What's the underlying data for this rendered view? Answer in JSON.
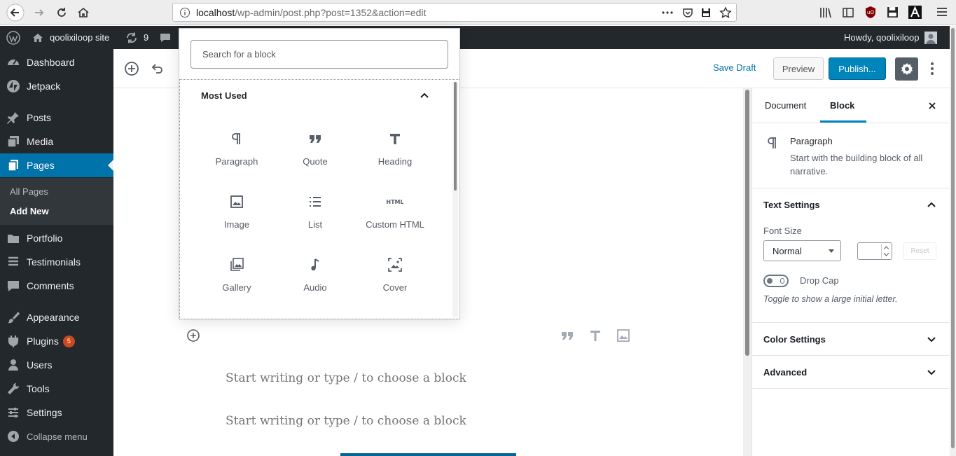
{
  "browser": {
    "url_host": "localhost",
    "url_path": "/wp-admin/post.php?post=1352&action=edit"
  },
  "admin_bar": {
    "site_name": "qoolixiloop site",
    "updates_count": "9",
    "greeting": "Howdy, qoolixiloop"
  },
  "admin_menu": {
    "items": [
      {
        "label": "Dashboard"
      },
      {
        "label": "Jetpack"
      },
      {
        "label": "Posts"
      },
      {
        "label": "Media"
      },
      {
        "label": "Pages"
      },
      {
        "label": "Portfolio"
      },
      {
        "label": "Testimonials"
      },
      {
        "label": "Comments"
      },
      {
        "label": "Appearance"
      },
      {
        "label": "Plugins",
        "badge": "5"
      },
      {
        "label": "Users"
      },
      {
        "label": "Tools"
      },
      {
        "label": "Settings"
      },
      {
        "label": "Collapse menu"
      }
    ],
    "submenu": [
      {
        "label": "All Pages"
      },
      {
        "label": "Add New"
      }
    ]
  },
  "editor_header": {
    "save_draft": "Save Draft",
    "preview": "Preview",
    "publish": "Publish..."
  },
  "inserter": {
    "search_placeholder": "Search for a block",
    "section_title": "Most Used",
    "blocks": [
      {
        "label": "Paragraph",
        "icon": "paragraph-icon"
      },
      {
        "label": "Quote",
        "icon": "quote-icon"
      },
      {
        "label": "Heading",
        "icon": "heading-icon"
      },
      {
        "label": "Image",
        "icon": "image-icon"
      },
      {
        "label": "List",
        "icon": "list-icon"
      },
      {
        "label": "Custom HTML",
        "icon": "html-icon"
      },
      {
        "label": "Gallery",
        "icon": "gallery-icon"
      },
      {
        "label": "Audio",
        "icon": "audio-icon"
      },
      {
        "label": "Cover",
        "icon": "cover-icon"
      }
    ]
  },
  "content": {
    "placeholder_1": "Start writing or type / to choose a block",
    "placeholder_2": "Start writing or type / to choose a block"
  },
  "sidebar": {
    "tab_document": "Document",
    "tab_block": "Block",
    "block_name": "Paragraph",
    "block_description": "Start with the building block of all narrative.",
    "text_settings_title": "Text Settings",
    "font_size_label": "Font Size",
    "font_size_value": "Normal",
    "reset_label": "Reset",
    "drop_cap_label": "Drop Cap",
    "drop_cap_help": "Toggle to show a large initial letter.",
    "color_settings_title": "Color Settings",
    "advanced_title": "Advanced"
  }
}
